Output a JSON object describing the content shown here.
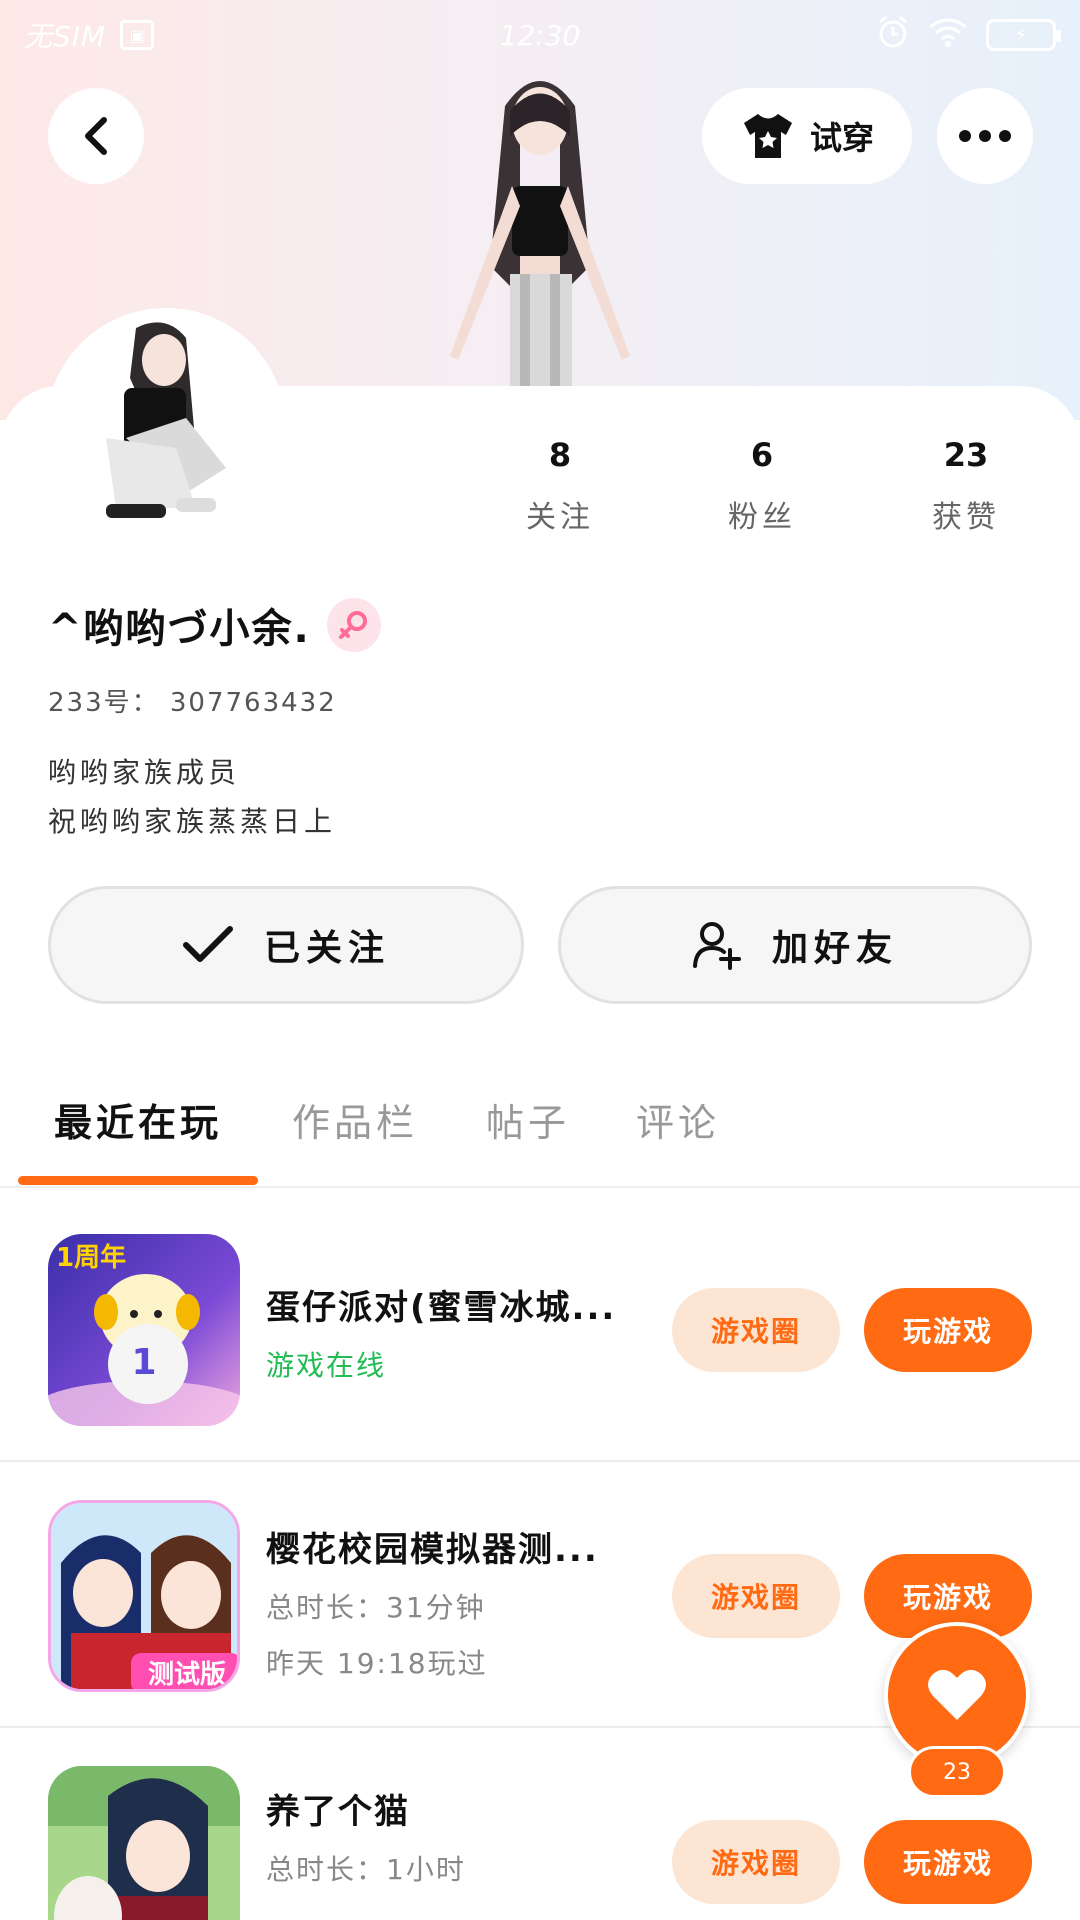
{
  "status_bar": {
    "carrier": "无SIM",
    "time": "12:30"
  },
  "header": {
    "tryon_label": "试穿"
  },
  "profile": {
    "stats": [
      {
        "value": "8",
        "label": "关注"
      },
      {
        "value": "6",
        "label": "粉丝"
      },
      {
        "value": "23",
        "label": "获赞"
      }
    ],
    "nickname": "^哟哟づ小余.",
    "uid_text": "233号： 307763432",
    "bio_lines": [
      "哟哟家族成员",
      "祝哟哟家族蒸蒸日上"
    ]
  },
  "actions": {
    "follow_label": "已关注",
    "add_friend_label": "加好友"
  },
  "tabs": [
    "最近在玩",
    "作品栏",
    "帖子",
    "评论"
  ],
  "games": [
    {
      "title": "蛋仔派对(蜜雪冰城...",
      "line1": "游戏在线",
      "line2": "",
      "circle_label": "游戏圈",
      "play_label": "玩游戏",
      "icon_text": "1周年"
    },
    {
      "title": "樱花校园模拟器测...",
      "line1": "总时长：31分钟",
      "line2": "昨天 19:18玩过",
      "circle_label": "游戏圈",
      "play_label": "玩游戏",
      "icon_text": "测试版"
    },
    {
      "title": "养了个猫",
      "line1": "总时长：1小时",
      "line2": "",
      "circle_label": "游戏圈",
      "play_label": "玩游戏",
      "icon_text": ""
    }
  ],
  "like_fab": {
    "count": "23"
  },
  "colors": {
    "accent": "#ff6a13",
    "accent_light": "#fde5d4",
    "online_green": "#22bb55"
  }
}
